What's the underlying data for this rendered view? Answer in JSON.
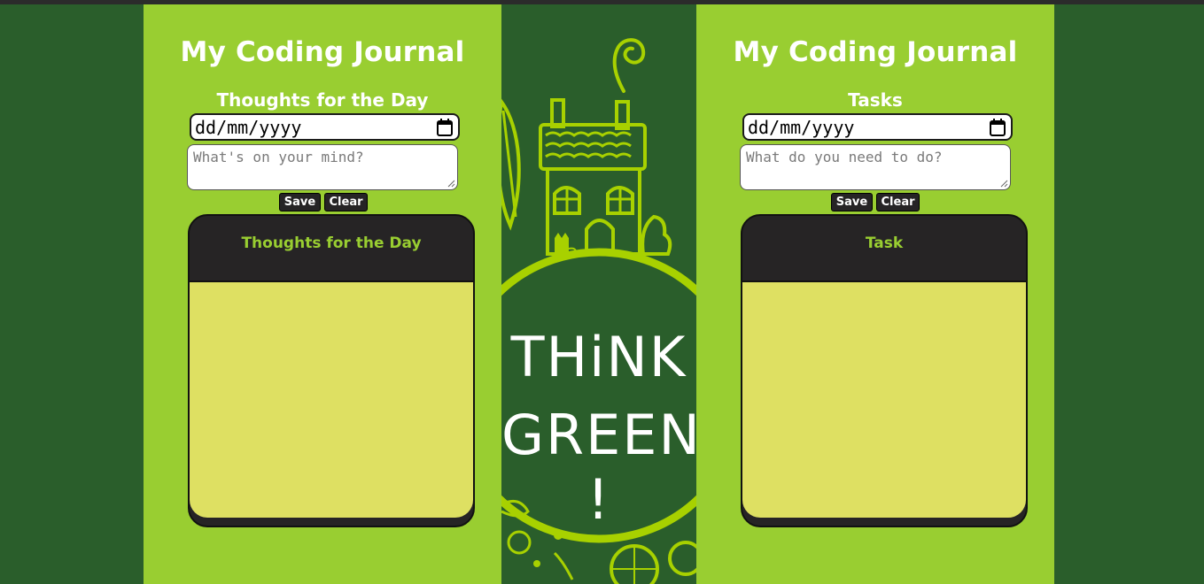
{
  "left_panel": {
    "title": "My Coding Journal",
    "subtitle": "Thoughts for the Day",
    "date_value": "dd/mm/yyyy",
    "textarea_placeholder": "What's on your mind?",
    "save_label": "Save",
    "clear_label": "Clear",
    "note_title": "Thoughts for the Day"
  },
  "right_panel": {
    "title": "My Coding Journal",
    "subtitle": "Tasks",
    "date_value": "dd/mm/yyyy",
    "textarea_placeholder": "What do you need to do?",
    "save_label": "Save",
    "clear_label": "Clear",
    "note_title": "Task"
  },
  "banner": {
    "line1": "THiNK",
    "line2": "GREEN !",
    "icon": "house-globe-illustration"
  },
  "colors": {
    "page_background": "#2a5e2b",
    "panel_green": "#99ce31",
    "note_header": "#262425",
    "note_paper": "#dee062",
    "accent_lime": "#a8d100"
  }
}
